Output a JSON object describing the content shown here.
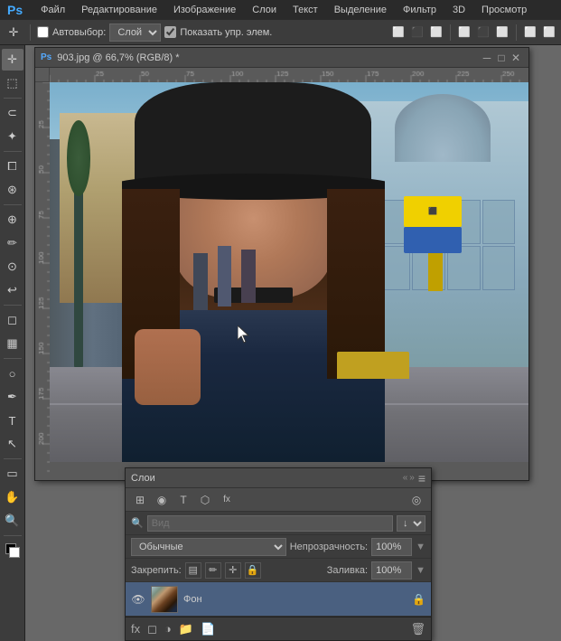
{
  "app": {
    "name": "Ps",
    "title": "Adobe Photoshop"
  },
  "menubar": {
    "items": [
      "Файл",
      "Редактирование",
      "Изображение",
      "Слои",
      "Текст",
      "Выделение",
      "Фильтр",
      "3D",
      "Просмотр"
    ]
  },
  "toolbar": {
    "autoselect_label": "Автовыбор:",
    "autoselect_option": "Слой",
    "show_elements_label": "Показать упр. элем.",
    "move_icon": "✛"
  },
  "document": {
    "title": "903.jpg @ 66,7% (RGB/8) *",
    "logo": "Ps",
    "min_btn": "─",
    "max_btn": "□",
    "close_btn": "✕"
  },
  "layers_panel": {
    "title": "Слои",
    "collapse_arrows": "«»",
    "menu_icon": "≡",
    "search_placeholder": "Вид",
    "mode": "Обычные",
    "opacity_label": "Непрозрачность:",
    "opacity_value": "100%",
    "lock_label": "Закрепить:",
    "fill_label": "Заливка:",
    "fill_value": "100%",
    "icons": {
      "kind": "⊞",
      "pixel": "◉",
      "text": "T",
      "path": "⬡",
      "effect": "fx",
      "panel_options": "◎"
    },
    "lock_icons": [
      "▤",
      "⊹",
      "⊕",
      "🔒"
    ],
    "layers": [
      {
        "visible": true,
        "name": "Фон",
        "locked": true,
        "has_thumb": true
      }
    ]
  },
  "status": {
    "text": ""
  },
  "colors": {
    "bg": "#686868",
    "panel_bg": "#3c3c3c",
    "titlebar_bg": "#4a4a4a",
    "active_layer": "#4a6080",
    "menubar_bg": "#2a2a2a",
    "accent": "#4a8fcc"
  }
}
